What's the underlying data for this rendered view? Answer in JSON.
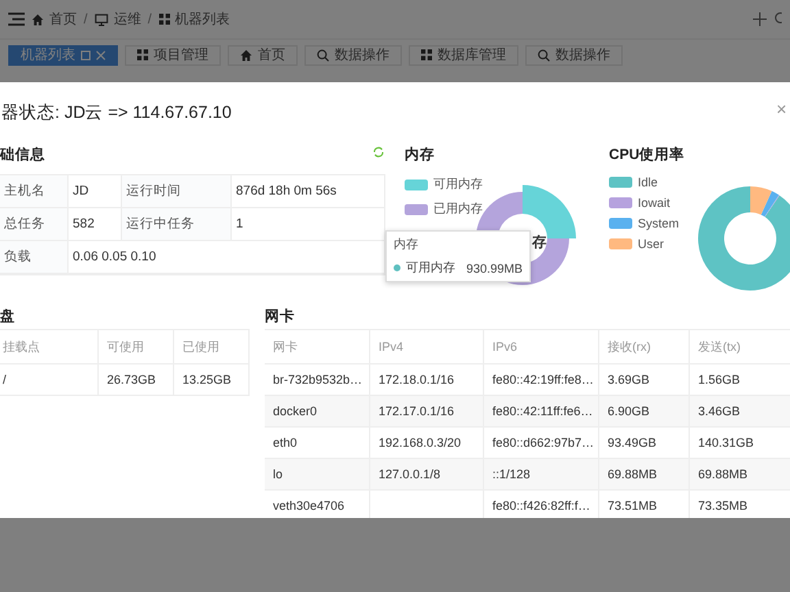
{
  "header": {
    "breadcrumbs": [
      {
        "label": "首页"
      },
      {
        "label": "运维"
      },
      {
        "label": "机器列表"
      }
    ],
    "separators": [
      "/",
      "/"
    ]
  },
  "tabs": [
    {
      "label": "机器列表",
      "selected": true
    },
    {
      "label": "项目管理",
      "selected": false
    },
    {
      "label": "首页",
      "selected": false
    },
    {
      "label": "数据操作",
      "selected": false
    },
    {
      "label": "数据库管理",
      "selected": false
    },
    {
      "label": "数据操作",
      "selected": false
    }
  ],
  "modal": {
    "title": "器状态: JD云 => 114.67.67.10",
    "close": "×",
    "basic_info": {
      "title": "础信息",
      "rows": [
        [
          {
            "kind": "label",
            "text": "主机名"
          },
          {
            "kind": "value",
            "text": "JD"
          },
          {
            "kind": "label",
            "text": "运行时间"
          },
          {
            "kind": "value",
            "text": "876d 18h 0m 56s"
          }
        ],
        [
          {
            "kind": "label",
            "text": "总任务"
          },
          {
            "kind": "value",
            "text": "582"
          },
          {
            "kind": "label",
            "text": "运行中任务"
          },
          {
            "kind": "value",
            "text": "1"
          }
        ],
        [
          {
            "kind": "label",
            "text": "负载"
          },
          {
            "kind": "value",
            "text": "0.06 0.05 0.10"
          }
        ]
      ]
    },
    "memory": {
      "title": "内存",
      "legend": [
        {
          "label": "可用内存",
          "color": "#66d4d8"
        },
        {
          "label": "已用内存",
          "color": "#b4a4dc"
        }
      ],
      "center_label": "存",
      "tooltip": {
        "title": "内存",
        "series": "可用内存",
        "value": "930.99MB",
        "color": "#5fc0c0"
      }
    },
    "cpu": {
      "title": "CPU使用率",
      "legend": [
        {
          "label": "Idle",
          "color": "#5ec3c4"
        },
        {
          "label": "Iowait",
          "color": "#b6a2de"
        },
        {
          "label": "System",
          "color": "#5ab1ef"
        },
        {
          "label": "User",
          "color": "#ffb980"
        }
      ]
    },
    "disk": {
      "title": "盘",
      "columns": [
        "挂载点",
        "可使用",
        "已使用"
      ],
      "rows": [
        [
          "/",
          "26.73GB",
          "13.25GB"
        ]
      ]
    },
    "network": {
      "title": "网卡",
      "columns": [
        "网卡",
        "IPv4",
        "IPv6",
        "接收(rx)",
        "发送(tx)"
      ],
      "rows": [
        [
          "br-732b9532b…",
          "172.18.0.1/16",
          "fe80::42:19ff:fe8…",
          "3.69GB",
          "1.56GB"
        ],
        [
          "docker0",
          "172.17.0.1/16",
          "fe80::42:11ff:fe6…",
          "6.90GB",
          "3.46GB"
        ],
        [
          "eth0",
          "192.168.0.3/20",
          "fe80::d662:97b7…",
          "93.49GB",
          "140.31GB"
        ],
        [
          "lo",
          "127.0.0.1/8",
          "::1/128",
          "69.88MB",
          "69.88MB"
        ],
        [
          "veth30e4706",
          "",
          "fe80::f426:82ff:f…",
          "73.51MB",
          "73.35MB"
        ]
      ]
    }
  }
}
